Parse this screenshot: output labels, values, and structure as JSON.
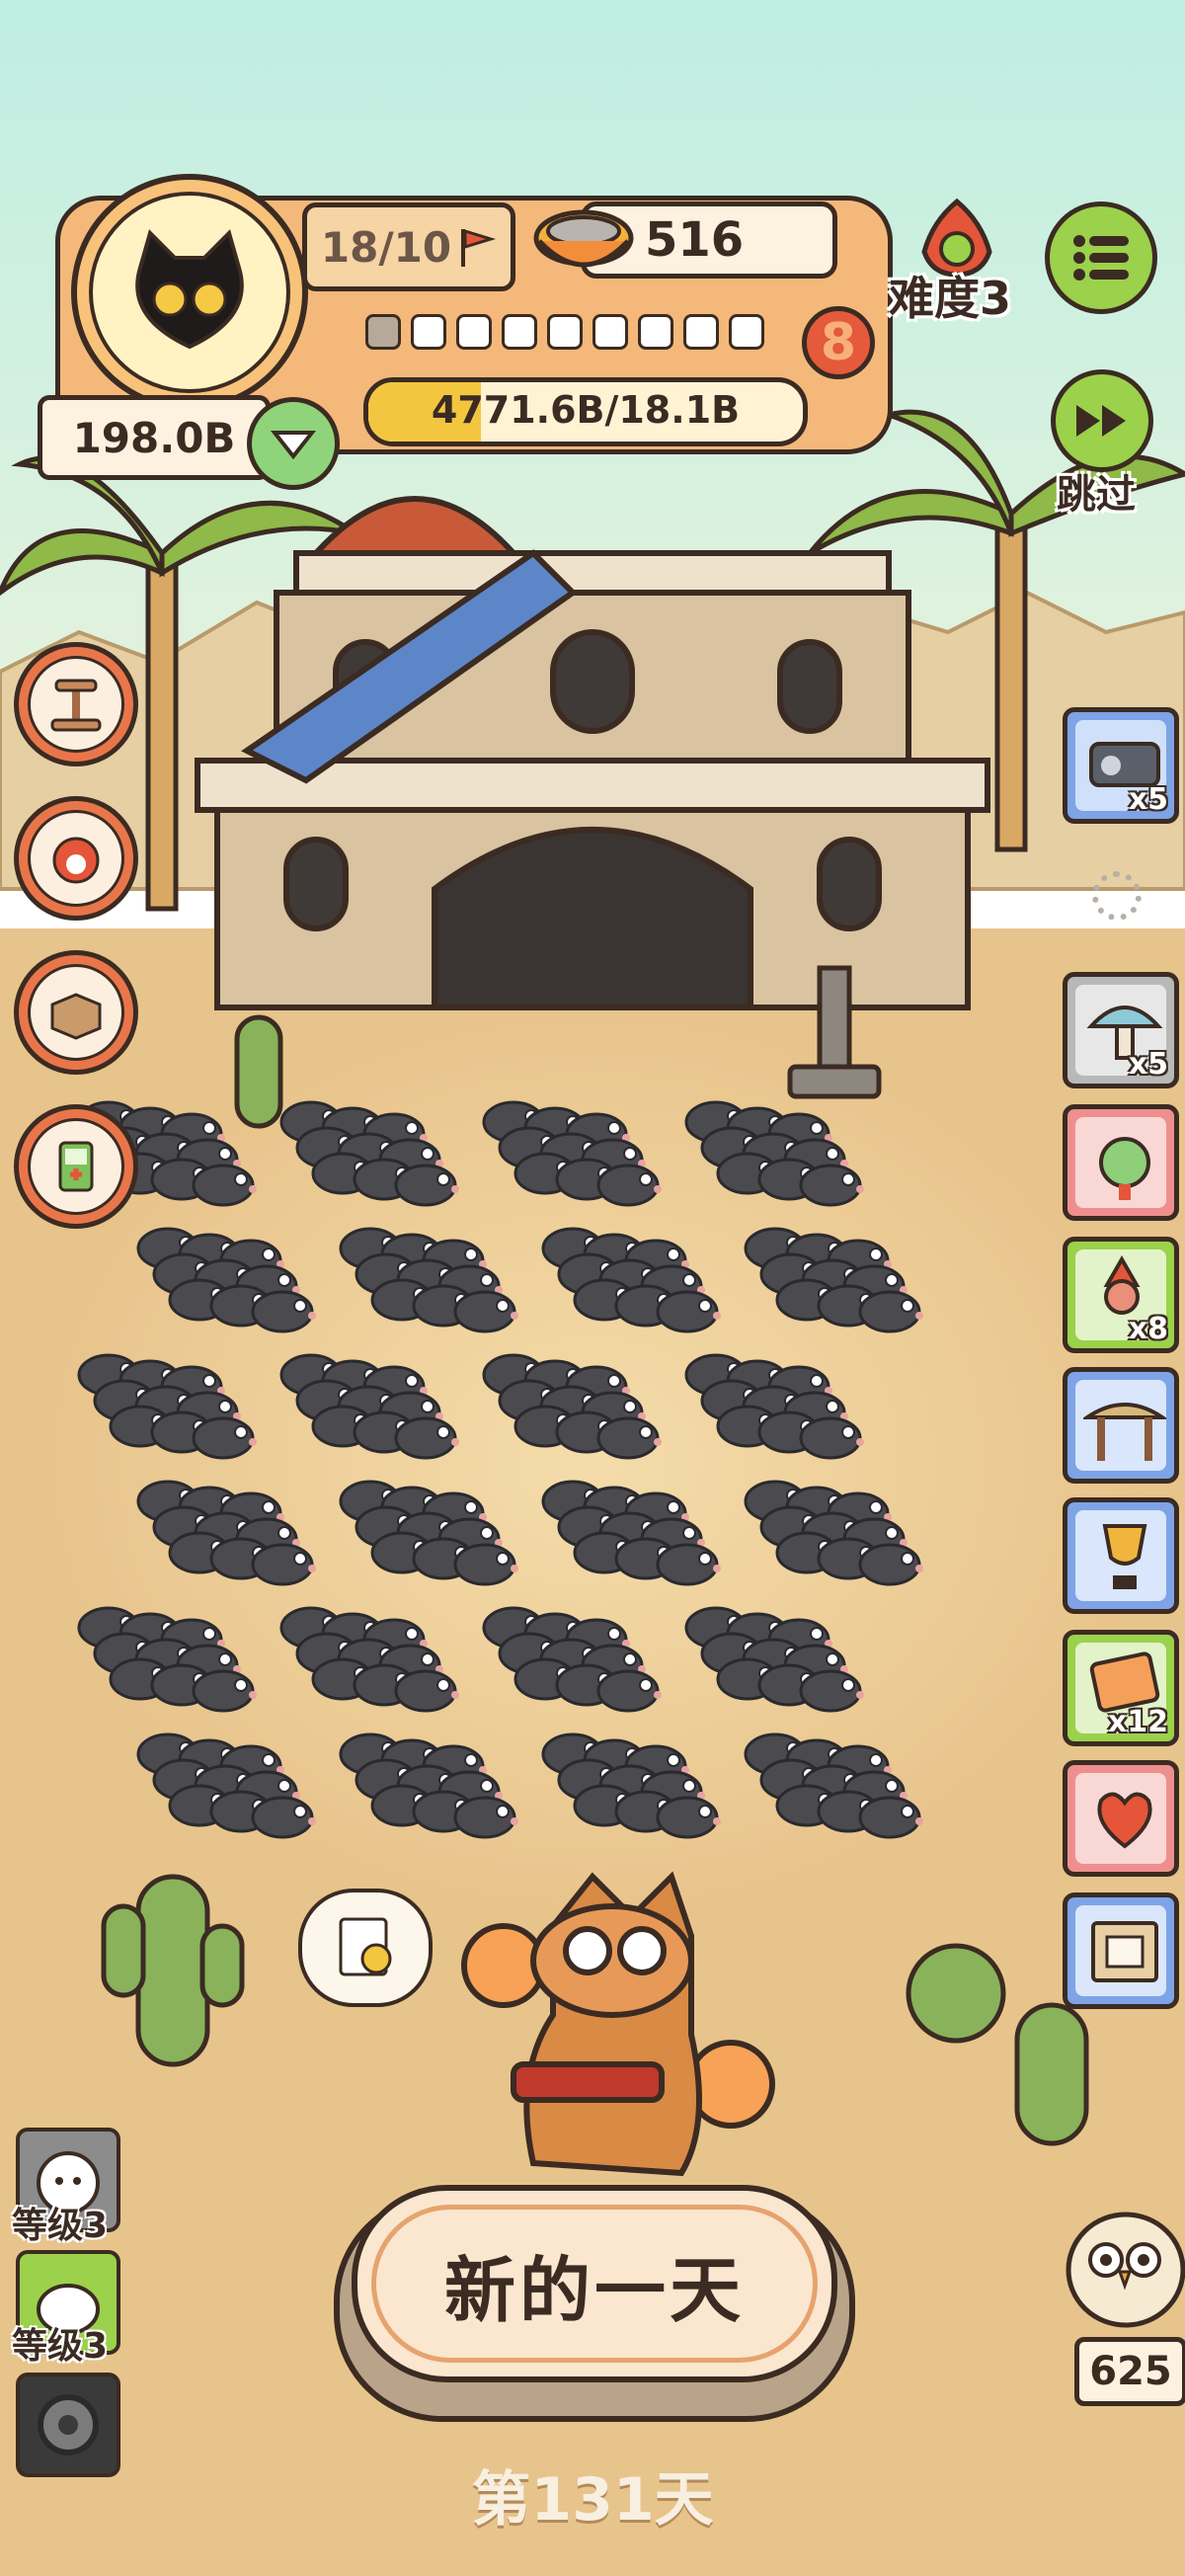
{
  "hud": {
    "flags": "18/10",
    "food": "516",
    "pips_filled": 1,
    "pips_total": 9,
    "level_badge": "8",
    "progress_text": "4771.6B/18.1B",
    "progress_fraction": 0.26,
    "money": "198.0B",
    "difficulty": "难度3",
    "skip": "跳过"
  },
  "side_counts": {
    "item1": "x5",
    "item3": "x5",
    "item5": "x8",
    "item9": "x12"
  },
  "levels": {
    "level1": "等级3",
    "level2": "等级3"
  },
  "bottom": {
    "new_day": "新的一天",
    "day_count": "第131天",
    "owl_count": "625"
  },
  "colors": {
    "sky_top": "#c4efe0",
    "sand": "#e7c48b",
    "hud_orange": "#f4b97a",
    "accent_green": "#9bd14b",
    "badge_red": "#e45a3a"
  },
  "icons": {
    "avatar": "black-cat-avatar-icon",
    "flag": "flag-icon",
    "bowl": "food-bowl-icon",
    "menu": "menu-icon",
    "skip": "fast-forward-icon"
  }
}
